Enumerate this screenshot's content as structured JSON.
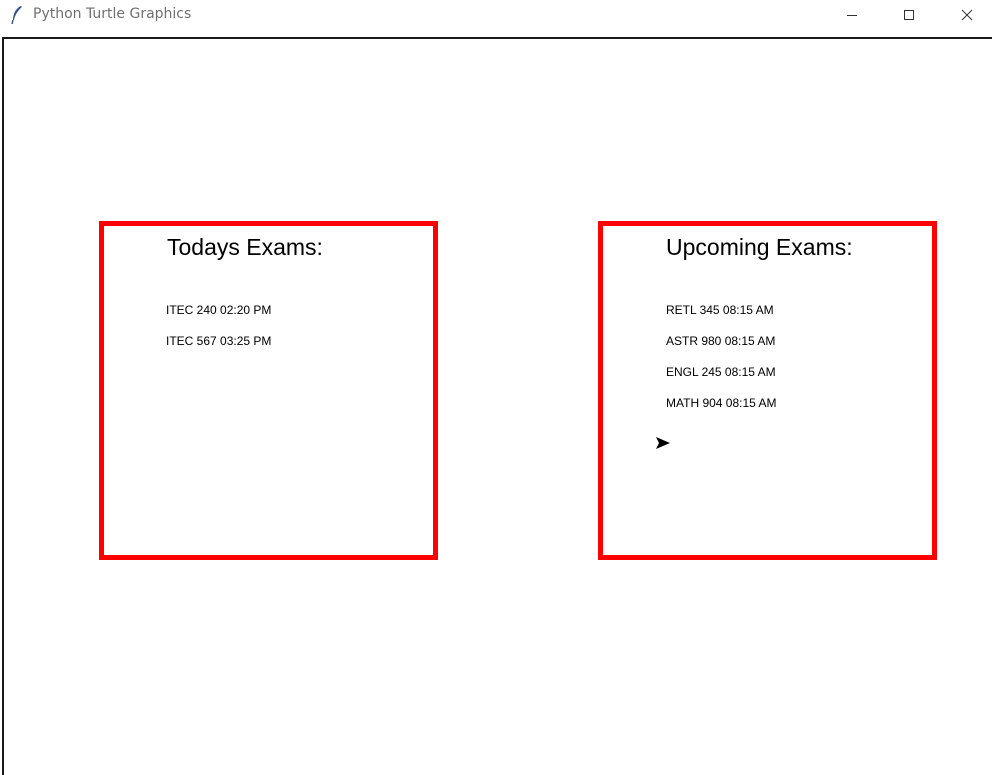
{
  "window": {
    "title": "Python Turtle Graphics",
    "icon": "feather-icon",
    "controls": [
      "minimize-icon",
      "maximize-icon",
      "close-icon"
    ]
  },
  "todays": {
    "heading": "Todays Exams:",
    "items": [
      "ITEC 240 02:20 PM",
      "ITEC 567 03:25 PM"
    ]
  },
  "upcoming": {
    "heading": "Upcoming Exams:",
    "items": [
      "RETL 345 08:15 AM",
      "ASTR 980 08:15 AM",
      "ENGL 245 08:15 AM",
      "MATH 904 08:15 AM"
    ]
  },
  "colors": {
    "box_border": "#ff0000",
    "text": "#000000",
    "title_text": "#707070"
  },
  "turtle": {
    "icon": "turtle-arrow-icon"
  }
}
